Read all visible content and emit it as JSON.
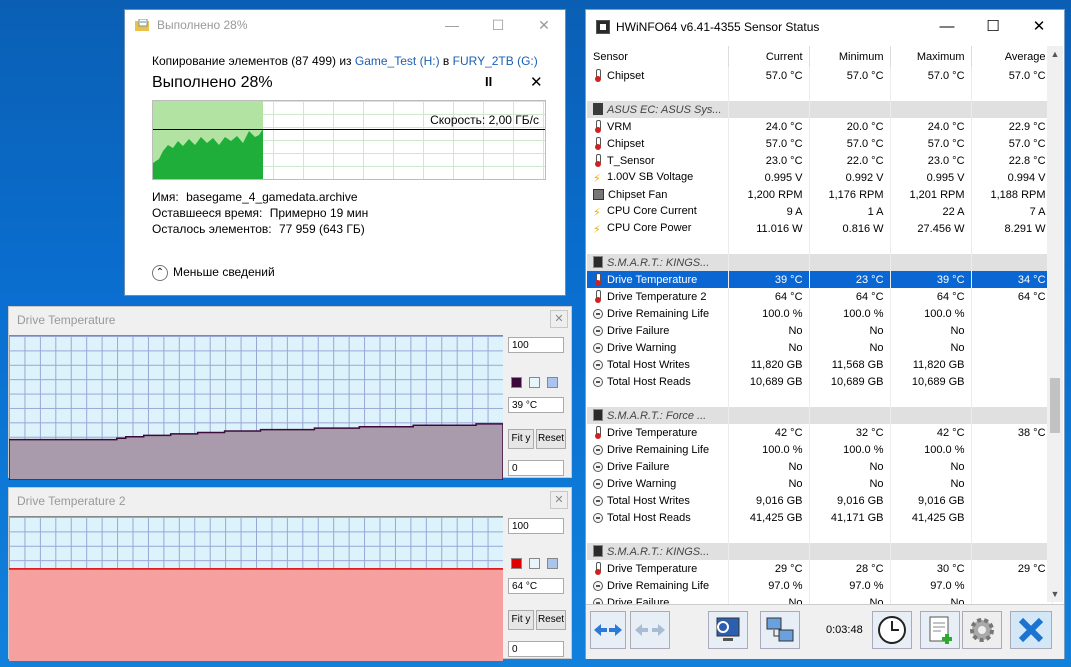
{
  "copy_dialog": {
    "title": "Выполнено 28%",
    "line_prefix": "Копирование элементов (87 499) из",
    "source": "Game_Test (H:)",
    "to_word": "в",
    "dest": "FURY_2TB (G:)",
    "progress_label": "Выполнено 28%",
    "progress_percent": 28,
    "speed": "Скорость: 2,00 ГБ/с",
    "name_label": "Имя:",
    "name_value": "basegame_4_gamedata.archive",
    "time_label": "Оставшееся время:",
    "time_value": "Примерно 19 мин",
    "items_label": "Осталось элементов:",
    "items_value": "77 959 (643 ГБ)",
    "less_details": "Меньше сведений",
    "pause_glyph": "II",
    "close_glyph": "✕"
  },
  "graph1": {
    "title": "Drive Temperature",
    "max": "100",
    "current": "39 °C",
    "min": "0",
    "fit": "Fit y",
    "reset": "Reset",
    "color": "#3b0a3b",
    "series": [
      28,
      28,
      28,
      28,
      28,
      28,
      28,
      28,
      28,
      28,
      28,
      28,
      29,
      30,
      30,
      31,
      31,
      31,
      32,
      32,
      32,
      33,
      33,
      33,
      34,
      34,
      34,
      34,
      35,
      35,
      35,
      35,
      35,
      35,
      36,
      36,
      36,
      36,
      36,
      37,
      37,
      37,
      37,
      37,
      37,
      38,
      38,
      38,
      38,
      38,
      38,
      38,
      39,
      39,
      39
    ]
  },
  "graph2": {
    "title": "Drive Temperature 2",
    "max": "100",
    "current": "64 °C",
    "min": "0",
    "fit": "Fit y",
    "reset": "Reset",
    "color": "#e00000",
    "value": 64
  },
  "hwinfo": {
    "title": "HWiNFO64 v6.41-4355 Sensor Status",
    "columns": [
      "Sensor",
      "Current",
      "Minimum",
      "Maximum",
      "Average"
    ],
    "rows": [
      {
        "t": "s",
        "icon": "t",
        "name": "Chipset",
        "cur": "57.0 °C",
        "min": "57.0 °C",
        "max": "57.0 °C",
        "avg": "57.0 °C"
      },
      {
        "t": "b"
      },
      {
        "t": "g",
        "icon": "d",
        "name": "ASUS EC: ASUS Sys..."
      },
      {
        "t": "s",
        "icon": "t",
        "name": "VRM",
        "cur": "24.0 °C",
        "min": "20.0 °C",
        "max": "24.0 °C",
        "avg": "22.9 °C"
      },
      {
        "t": "s",
        "icon": "t",
        "name": "Chipset",
        "cur": "57.0 °C",
        "min": "57.0 °C",
        "max": "57.0 °C",
        "avg": "57.0 °C"
      },
      {
        "t": "s",
        "icon": "t",
        "name": "T_Sensor",
        "cur": "23.0 °C",
        "min": "22.0 °C",
        "max": "23.0 °C",
        "avg": "22.8 °C"
      },
      {
        "t": "s",
        "icon": "v",
        "name": "1.00V SB Voltage",
        "cur": "0.995 V",
        "min": "0.992 V",
        "max": "0.995 V",
        "avg": "0.994 V"
      },
      {
        "t": "s",
        "icon": "f",
        "name": "Chipset Fan",
        "cur": "1,200 RPM",
        "min": "1,176 RPM",
        "max": "1,201 RPM",
        "avg": "1,188 RPM"
      },
      {
        "t": "s",
        "icon": "v",
        "name": "CPU Core Current",
        "cur": "9 A",
        "min": "1 A",
        "max": "22 A",
        "avg": "7 A"
      },
      {
        "t": "s",
        "icon": "v",
        "name": "CPU Core Power",
        "cur": "11.016 W",
        "min": "0.816 W",
        "max": "27.456 W",
        "avg": "8.291 W"
      },
      {
        "t": "b"
      },
      {
        "t": "g",
        "icon": "dg",
        "name": "S.M.A.R.T.: KINGS..."
      },
      {
        "t": "s",
        "icon": "t",
        "name": "Drive Temperature",
        "cur": "39 °C",
        "min": "23 °C",
        "max": "39 °C",
        "avg": "34 °C",
        "sel": true
      },
      {
        "t": "s",
        "icon": "t",
        "name": "Drive Temperature 2",
        "cur": "64 °C",
        "min": "64 °C",
        "max": "64 °C",
        "avg": "64 °C"
      },
      {
        "t": "s",
        "icon": "o",
        "name": "Drive Remaining Life",
        "cur": "100.0 %",
        "min": "100.0 %",
        "max": "100.0 %",
        "avg": ""
      },
      {
        "t": "s",
        "icon": "o",
        "name": "Drive Failure",
        "cur": "No",
        "min": "No",
        "max": "No",
        "avg": ""
      },
      {
        "t": "s",
        "icon": "o",
        "name": "Drive Warning",
        "cur": "No",
        "min": "No",
        "max": "No",
        "avg": ""
      },
      {
        "t": "s",
        "icon": "o",
        "name": "Total Host Writes",
        "cur": "11,820 GB",
        "min": "11,568 GB",
        "max": "11,820 GB",
        "avg": ""
      },
      {
        "t": "s",
        "icon": "o",
        "name": "Total Host Reads",
        "cur": "10,689 GB",
        "min": "10,689 GB",
        "max": "10,689 GB",
        "avg": ""
      },
      {
        "t": "b"
      },
      {
        "t": "g",
        "icon": "dg",
        "name": "S.M.A.R.T.: Force ..."
      },
      {
        "t": "s",
        "icon": "t",
        "name": "Drive Temperature",
        "cur": "42 °C",
        "min": "32 °C",
        "max": "42 °C",
        "avg": "38 °C"
      },
      {
        "t": "s",
        "icon": "o",
        "name": "Drive Remaining Life",
        "cur": "100.0 %",
        "min": "100.0 %",
        "max": "100.0 %",
        "avg": ""
      },
      {
        "t": "s",
        "icon": "o",
        "name": "Drive Failure",
        "cur": "No",
        "min": "No",
        "max": "No",
        "avg": ""
      },
      {
        "t": "s",
        "icon": "o",
        "name": "Drive Warning",
        "cur": "No",
        "min": "No",
        "max": "No",
        "avg": ""
      },
      {
        "t": "s",
        "icon": "o",
        "name": "Total Host Writes",
        "cur": "9,016 GB",
        "min": "9,016 GB",
        "max": "9,016 GB",
        "avg": ""
      },
      {
        "t": "s",
        "icon": "o",
        "name": "Total Host Reads",
        "cur": "41,425 GB",
        "min": "41,171 GB",
        "max": "41,425 GB",
        "avg": ""
      },
      {
        "t": "b"
      },
      {
        "t": "g",
        "icon": "dg",
        "name": "S.M.A.R.T.: KINGS..."
      },
      {
        "t": "s",
        "icon": "t",
        "name": "Drive Temperature",
        "cur": "29 °C",
        "min": "28 °C",
        "max": "30 °C",
        "avg": "29 °C"
      },
      {
        "t": "s",
        "icon": "o",
        "name": "Drive Remaining Life",
        "cur": "97.0 %",
        "min": "97.0 %",
        "max": "97.0 %",
        "avg": ""
      },
      {
        "t": "s",
        "icon": "o",
        "name": "Drive Failure",
        "cur": "No",
        "min": "No",
        "max": "No",
        "avg": ""
      }
    ],
    "timer": "0:03:48",
    "footer_icons": [
      "arrows-left-right-icon",
      "arrows-disabled-icon",
      "monitor-icon",
      "network-icon",
      "clock-icon",
      "report-add-icon",
      "settings-gear-icon",
      "close-x-icon"
    ]
  }
}
